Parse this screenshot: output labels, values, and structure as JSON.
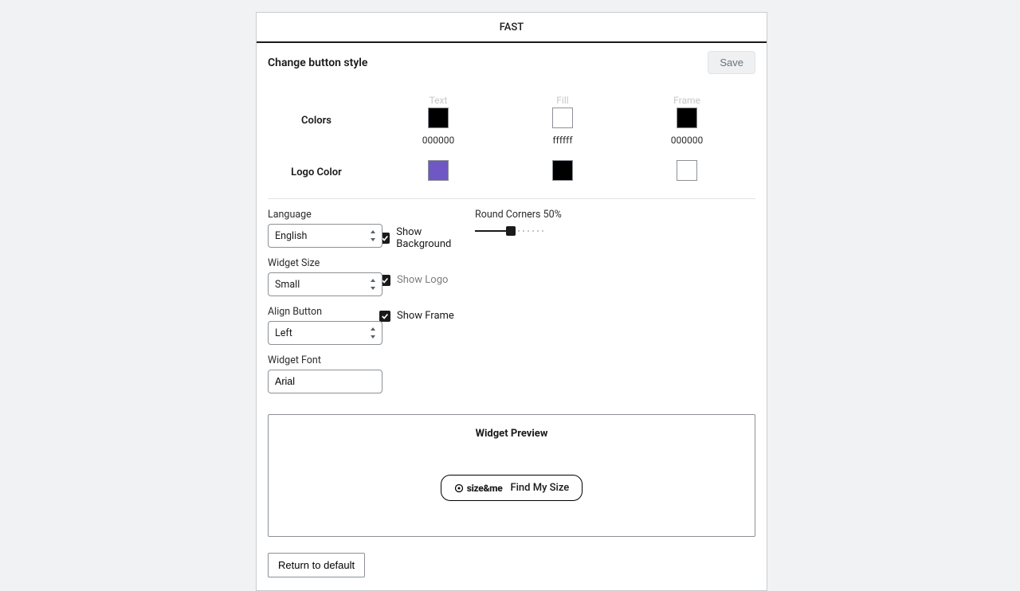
{
  "tab_label": "FAST",
  "header": {
    "title": "Change button style",
    "save_label": "Save"
  },
  "colors": {
    "row_label": "Colors",
    "text": {
      "label": "Text",
      "hex": "000000",
      "value": "#000000"
    },
    "fill": {
      "label": "Fill",
      "hex": "ffffff",
      "value": "#ffffff"
    },
    "frame": {
      "label": "Frame",
      "hex": "000000",
      "value": "#000000"
    }
  },
  "logo_color": {
    "row_label": "Logo Color",
    "options": [
      {
        "value": "#6f57c4"
      },
      {
        "value": "#000000"
      },
      {
        "value": "#ffffff"
      }
    ]
  },
  "language": {
    "label": "Language",
    "value": "English"
  },
  "widget_size": {
    "label": "Widget Size",
    "value": "Small"
  },
  "align": {
    "label": "Align Button",
    "value": "Left"
  },
  "font": {
    "label": "Widget Font",
    "value": "Arial"
  },
  "checks": {
    "show_background": {
      "label": "Show Background",
      "checked": true
    },
    "show_logo": {
      "label": "Show Logo",
      "checked": true
    },
    "show_frame": {
      "label": "Show Frame",
      "checked": true
    }
  },
  "slider": {
    "label": "Round Corners 50%",
    "percent": 50
  },
  "preview": {
    "title": "Widget Preview",
    "logo_text": "size&me",
    "button_label": "Find My Size"
  },
  "return_label": "Return to default"
}
